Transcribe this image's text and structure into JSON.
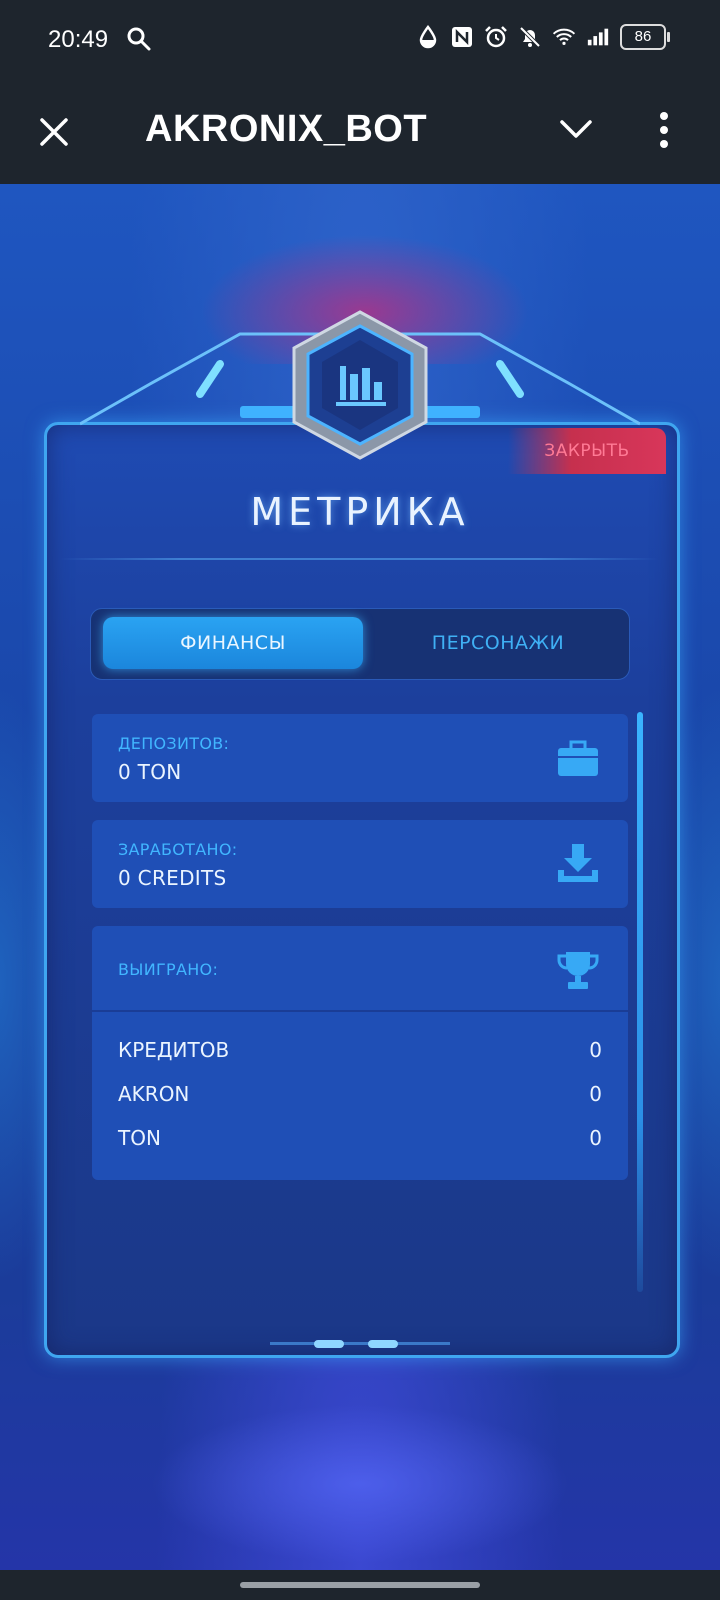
{
  "status_bar": {
    "time": "20:49",
    "battery": "86",
    "icons": [
      "search-icon",
      "data-saver-icon",
      "nfc-icon",
      "alarm-icon",
      "mute-icon",
      "wifi-icon",
      "signal-icon",
      "battery-icon"
    ]
  },
  "app_bar": {
    "title": "AKRONIX_BOT",
    "icons": [
      "close-icon",
      "chevron-down-icon",
      "more-vert-icon"
    ]
  },
  "panel": {
    "close_label": "ЗАКРЫТЬ",
    "title": "МЕТРИКА",
    "emblem_icon": "bar-chart-icon",
    "tabs": [
      {
        "label": "ФИНАНСЫ",
        "active": true
      },
      {
        "label": "ПЕРСОНАЖИ",
        "active": false
      }
    ],
    "cards": {
      "deposits": {
        "label": "ДЕПОЗИТОВ:",
        "value": "0 TON",
        "icon": "briefcase-icon"
      },
      "earned": {
        "label": "ЗАРАБОТАНО:",
        "value": "0 CREDITS",
        "icon": "download-icon"
      },
      "won": {
        "label": "ВЫИГРАНО:",
        "icon": "trophy-icon",
        "rows": [
          {
            "name": "КРЕДИТОВ",
            "value": "0"
          },
          {
            "name": "AKRON",
            "value": "0"
          },
          {
            "name": "TON",
            "value": "0"
          }
        ]
      }
    }
  },
  "colors": {
    "accent": "#41b6ff",
    "panel_bg": "#1c3f9c",
    "close_red": "#d8365a",
    "app_bar_bg": "#1e252d"
  }
}
